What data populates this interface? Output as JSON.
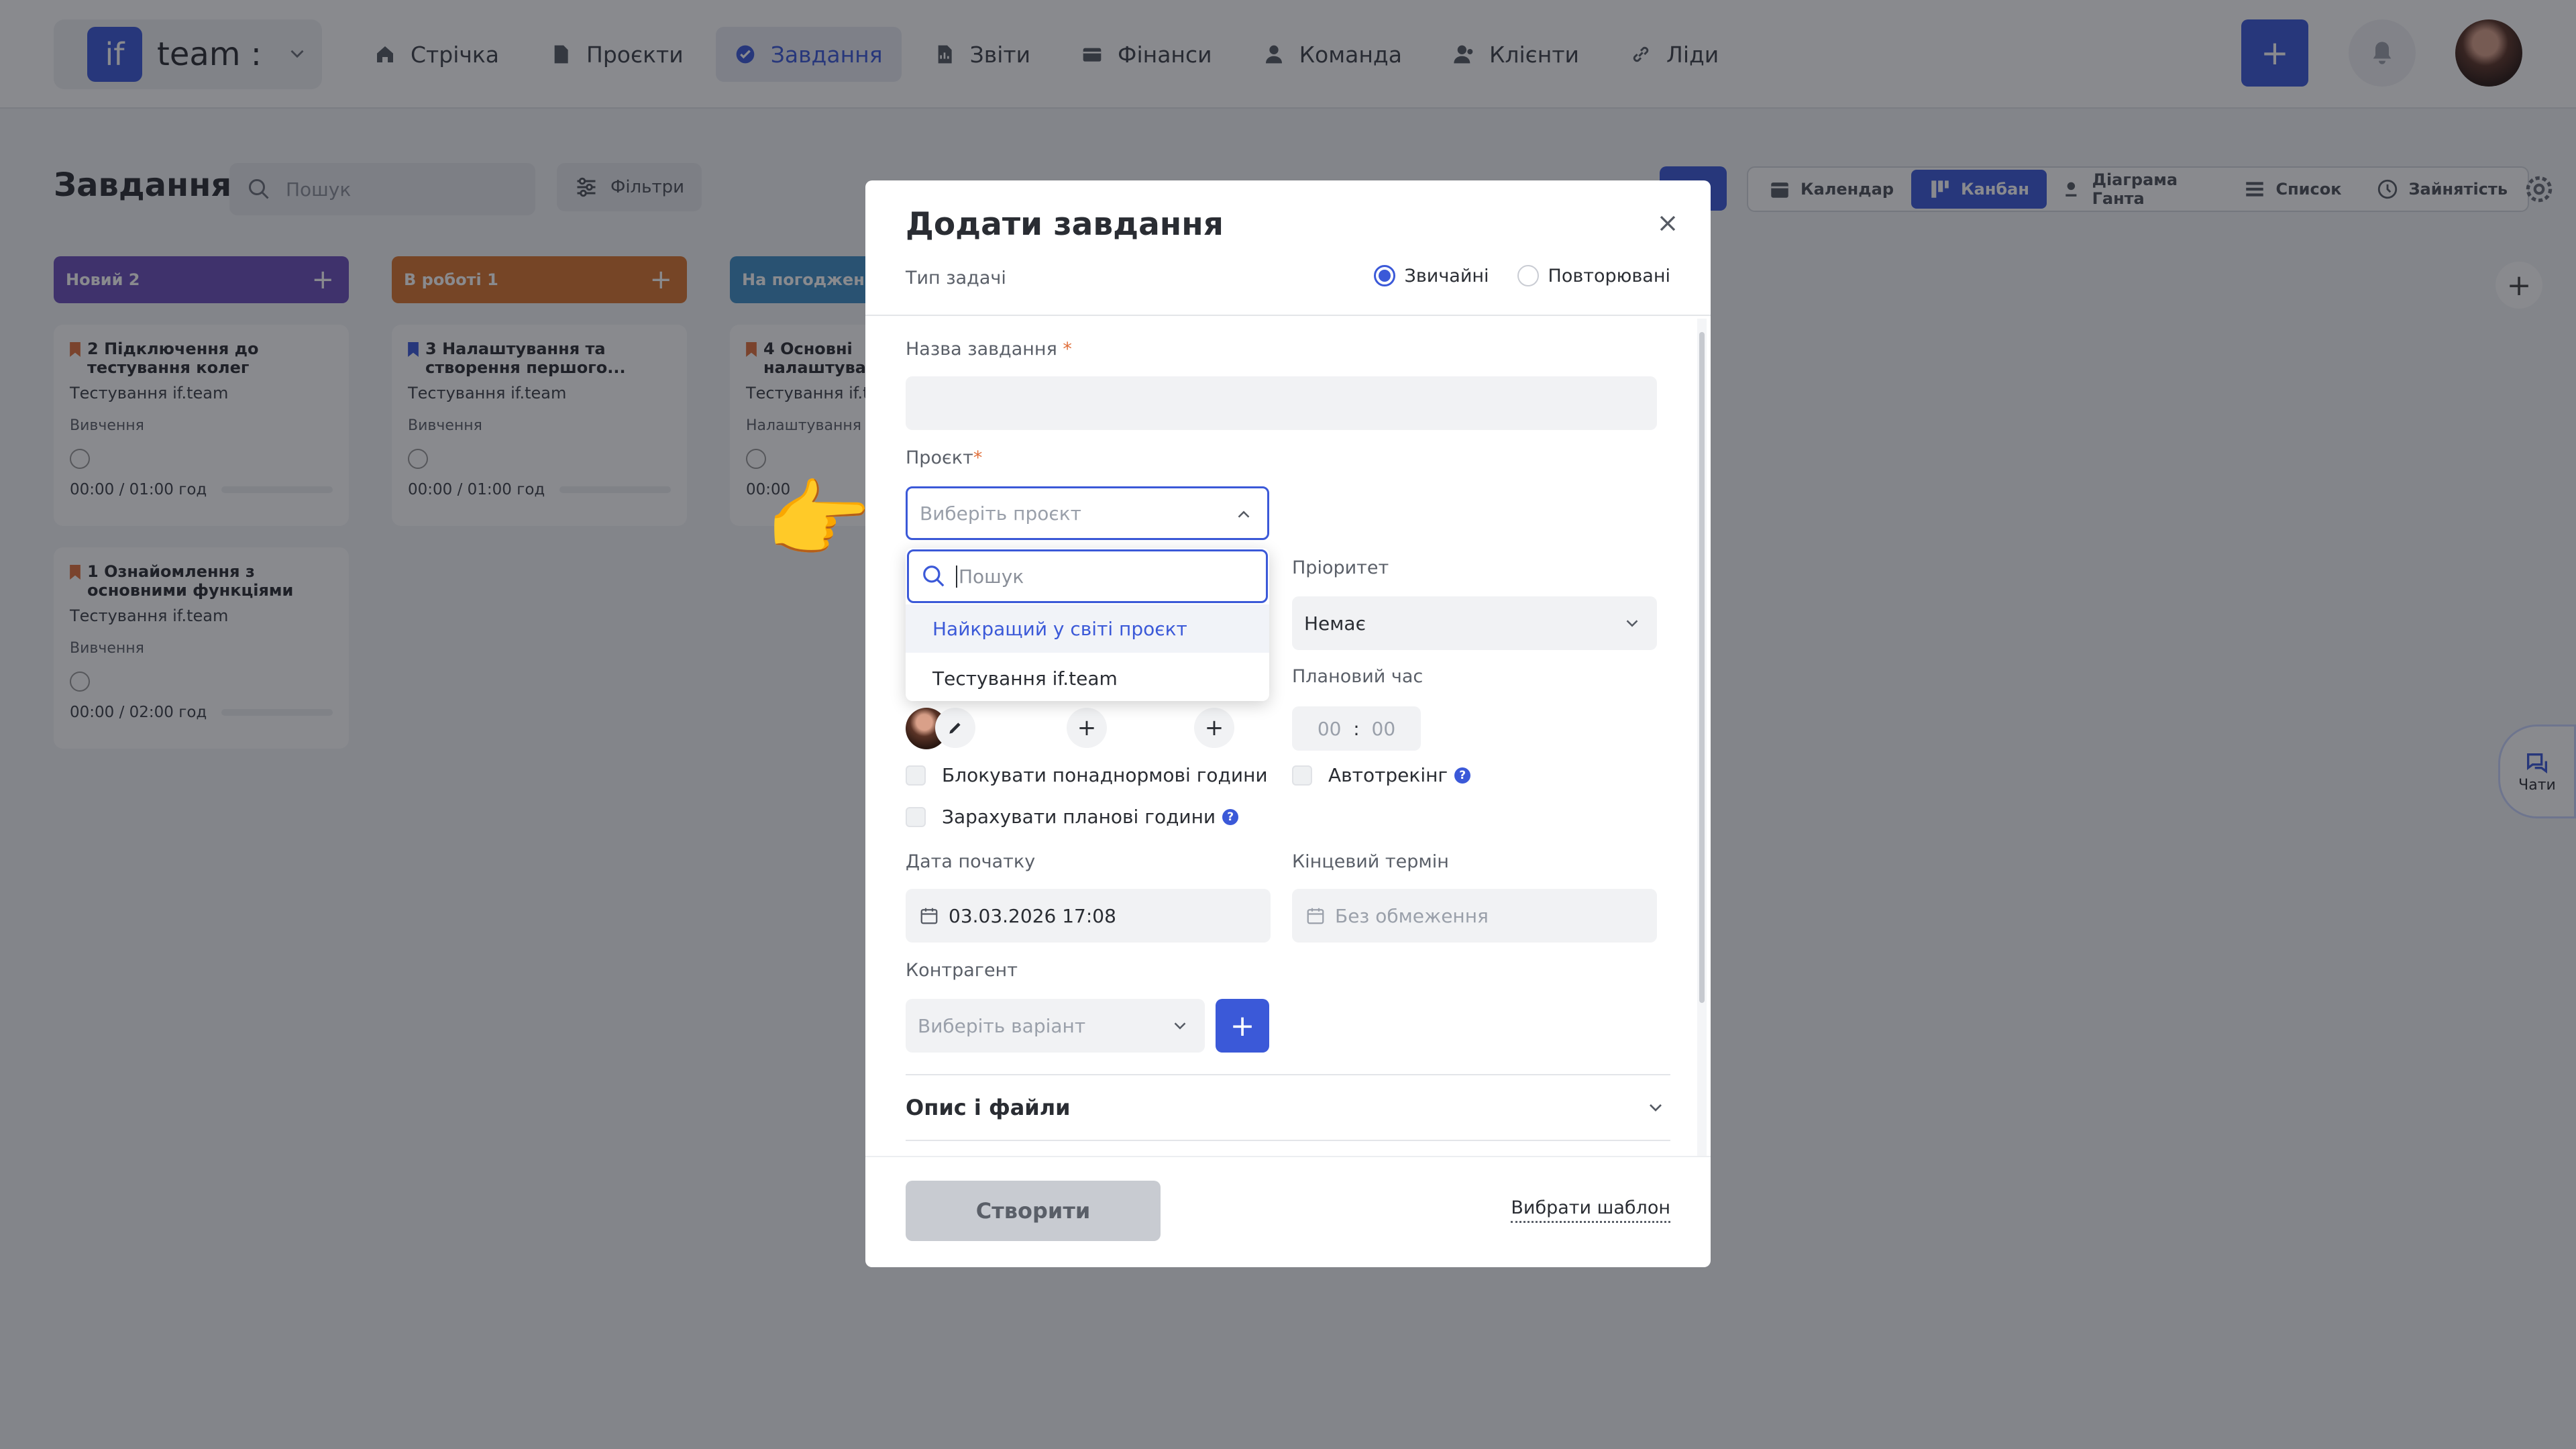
{
  "brand": {
    "logo": "if",
    "name": "team :"
  },
  "nav": [
    {
      "label": "Стрічка",
      "icon": "home-icon"
    },
    {
      "label": "Проєкти",
      "icon": "document-icon"
    },
    {
      "label": "Завдання",
      "icon": "check-circle-icon"
    },
    {
      "label": "Звіти",
      "icon": "report-icon"
    },
    {
      "label": "Фінанси",
      "icon": "wallet-icon"
    },
    {
      "label": "Команда",
      "icon": "person-icon"
    },
    {
      "label": "Клієнти",
      "icon": "clients-icon"
    },
    {
      "label": "Ліди",
      "icon": "link-icon"
    }
  ],
  "header": {
    "add": "+"
  },
  "page": {
    "title": "Завдання",
    "search_placeholder": "Пошук",
    "filters": "Фільтри"
  },
  "views": [
    {
      "label": "Календар"
    },
    {
      "label": "Канбан"
    },
    {
      "label": "Діаграма Ганта"
    },
    {
      "label": "Список"
    },
    {
      "label": "Зайнятість"
    }
  ],
  "columns": [
    {
      "title": "Новий",
      "count": "2",
      "color": "#6b4fbb"
    },
    {
      "title": "В роботі",
      "count": "1",
      "color": "#d9742f"
    },
    {
      "title": "На погодженні",
      "count": "",
      "color": "#3f8fc6"
    }
  ],
  "cards": [
    {
      "num": "2",
      "title": "Підключення до тестування колег",
      "project": "Тестування if.team",
      "type": "Вивчення",
      "time": "00:00 / 01:00 год",
      "flag": "#e0703c"
    },
    {
      "num": "1",
      "title": "Ознайомлення з основними функціями",
      "project": "Тестування if.team",
      "type": "Вивчення",
      "time": "00:00 / 02:00 год",
      "flag": "#e0703c"
    },
    {
      "num": "3",
      "title": "Налаштування та створення першого...",
      "project": "Тестування if.team",
      "type": "Вивчення",
      "time": "00:00 / 01:00 год",
      "flag": "#3b59d8"
    },
    {
      "num": "4",
      "title": "Основні налаштування",
      "project": "Тестування if.team",
      "type": "Налаштування",
      "time": "00:00",
      "flag": "#e0703c"
    }
  ],
  "chats": "Чати",
  "modal": {
    "title": "Додати завдання",
    "task_type_label": "Тип задачі",
    "type_regular": "Звичайні",
    "type_recurring": "Повторювані",
    "name_label": "Назва завдання",
    "required": "*",
    "project_label": "Проєкт",
    "project_placeholder": "Виберіть проєкт",
    "search_placeholder": "Пошук",
    "project_options": [
      "Найкращий у світі проєкт",
      "Тестування if.team"
    ],
    "priority_label": "Пріоритет",
    "priority_value": "Немає",
    "planned_label": "Плановий час",
    "planned_h": "00",
    "planned_sep": ":",
    "planned_m": "00",
    "block_overtime": "Блокувати понаднормові години",
    "autotracking": "Автотрекінг",
    "count_planned": "Зарахувати планові години",
    "start_label": "Дата початку",
    "start_value": "03.03.2026 17:08",
    "deadline_label": "Кінцевий термін",
    "deadline_placeholder": "Без обмеження",
    "contractor_label": "Контрагент",
    "contractor_placeholder": "Виберіть варіант",
    "desc_files": "Опис і файли",
    "create": "Створити",
    "choose_template": "Вибрати шаблон",
    "info": "?",
    "plus": "+"
  },
  "pointer": "👉"
}
